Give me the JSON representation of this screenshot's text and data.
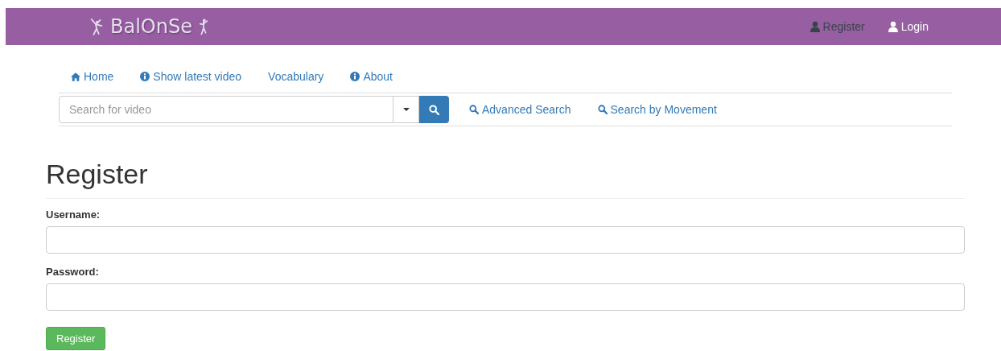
{
  "brand": {
    "name": "BalOnSe"
  },
  "header_links": [
    {
      "label": "Register",
      "selected": true
    },
    {
      "label": "Login",
      "selected": false
    }
  ],
  "nav": [
    {
      "label": "Home",
      "kind": "home"
    },
    {
      "label": "Show latest video",
      "kind": "info"
    },
    {
      "label": "Vocabulary",
      "kind": "plain"
    },
    {
      "label": "About",
      "kind": "info"
    }
  ],
  "search": {
    "placeholder": "Search for video"
  },
  "search_links": [
    {
      "label": "Advanced Search"
    },
    {
      "label": "Search by Movement"
    }
  ],
  "form": {
    "title": "Register",
    "fields": [
      {
        "label": "Username:"
      },
      {
        "label": "Password:"
      }
    ],
    "submit": "Register"
  }
}
